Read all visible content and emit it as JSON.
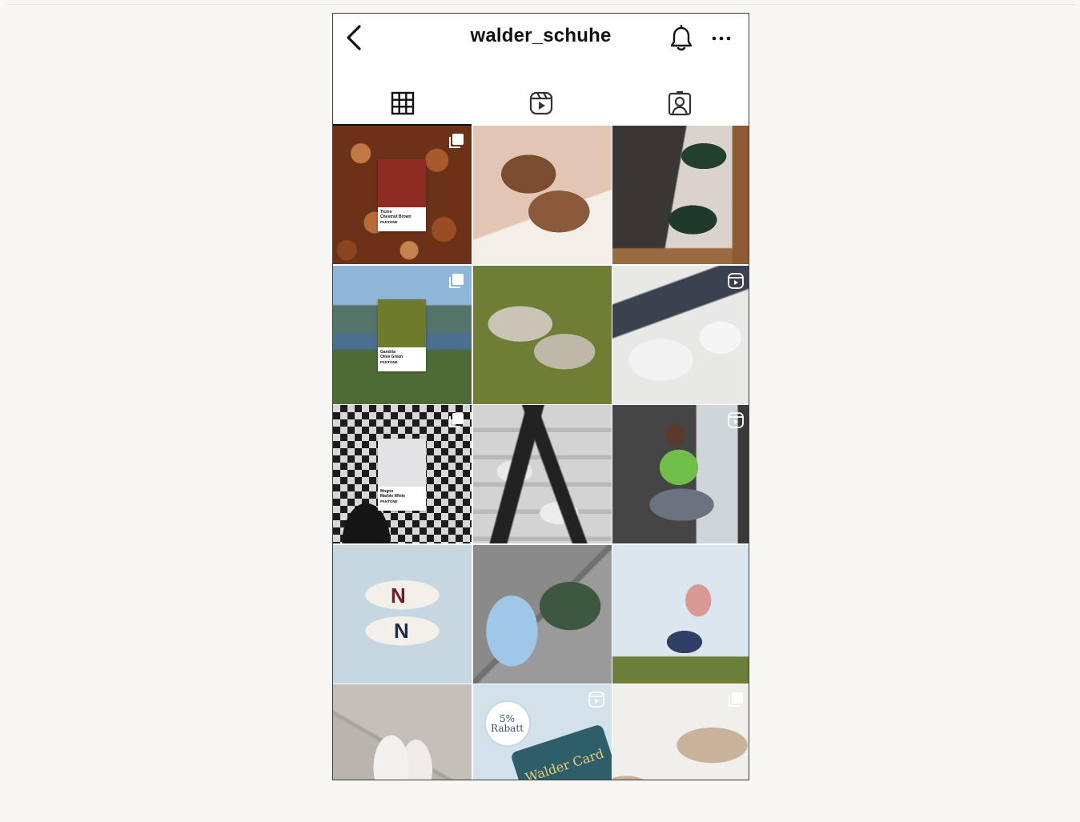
{
  "header": {
    "title": "walder_schuhe",
    "icons": {
      "back": "chevron-left-icon",
      "bell": "bell-icon",
      "more": "ellipsis-icon"
    }
  },
  "tabs": [
    {
      "id": "posts",
      "icon": "grid-icon",
      "active": true
    },
    {
      "id": "reels",
      "icon": "reels-icon",
      "active": false
    },
    {
      "id": "tagged",
      "icon": "tagged-person-icon",
      "active": false
    }
  ],
  "posts": [
    {
      "badge": "carousel",
      "swatch_color": "#8e2b22",
      "swatch_label": "Ticino\nChestnut Brown",
      "swatch_brand": "PANTONE"
    },
    {
      "badge": "none"
    },
    {
      "badge": "none"
    },
    {
      "badge": "carousel",
      "swatch_color": "#6e7b2a",
      "swatch_label": "Gandria\nOlive Green",
      "swatch_brand": "PANTONE"
    },
    {
      "badge": "none"
    },
    {
      "badge": "reel"
    },
    {
      "badge": "carousel",
      "swatch_color": "#e3e3e6",
      "swatch_label": "Mogno\nMarble White",
      "swatch_brand": "PANTONE"
    },
    {
      "badge": "none"
    },
    {
      "badge": "reel"
    },
    {
      "badge": "none"
    },
    {
      "badge": "none"
    },
    {
      "badge": "none"
    },
    {
      "badge": "none"
    },
    {
      "badge": "reel",
      "rabatt_text": "5%\nRabatt",
      "card_text": "Walder Card"
    },
    {
      "badge": "carousel"
    }
  ],
  "colors": {
    "accent": "#111111",
    "border": "#3a3a3a",
    "page_bg": "#f8f7f4"
  }
}
